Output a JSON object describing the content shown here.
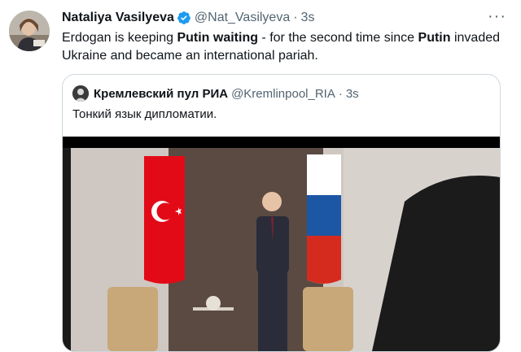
{
  "tweet": {
    "author_name": "Nataliya Vasilyeva",
    "author_handle": "@Nat_Vasilyeva",
    "separator": "·",
    "time": "3s",
    "more_label": "···",
    "text_parts": [
      "Erdogan is keeping ",
      "Putin waiting",
      " - for the second time since ",
      "Putin",
      " invaded Ukraine and became an international pariah."
    ]
  },
  "quote": {
    "author_name": "Кремлевский пул РИА",
    "author_handle": "@Kremlinpool_RIA",
    "separator": "·",
    "time": "3s",
    "text": "Тонкий язык дипломатии."
  },
  "icons": {
    "verified": "verified-badge-icon",
    "more": "more-options-icon"
  },
  "colors": {
    "verified_blue": "#1d9bf0",
    "secondary_text": "#536471",
    "border": "#cfd9de",
    "turkey_red": "#e30a17"
  }
}
